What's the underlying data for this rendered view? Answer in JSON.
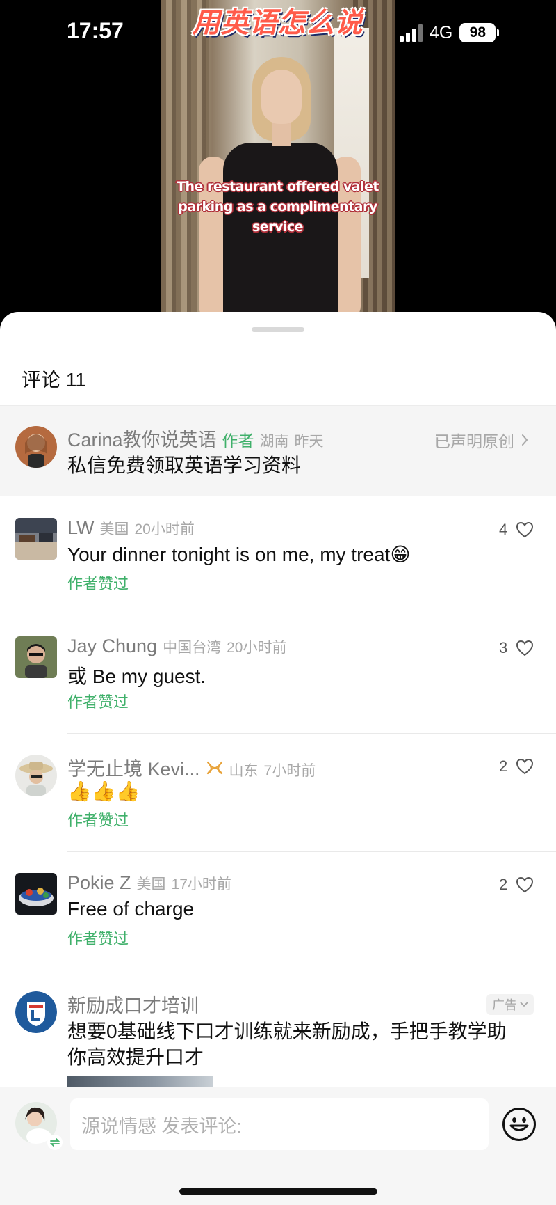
{
  "status_bar": {
    "time": "17:57",
    "network": "4G",
    "battery": "98"
  },
  "video": {
    "banner": "用英语怎么说",
    "caption": "The restaurant offered valet parking as a complimentary service"
  },
  "comments_sheet": {
    "title": "评论 11",
    "pinned": {
      "name": "Carina教你说英语",
      "author_tag": "作者",
      "location": "湖南",
      "time": "昨天",
      "declared": "已声明原创",
      "text": "私信免费领取英语学习资料"
    },
    "comments": [
      {
        "name": "LW",
        "location": "美国",
        "time": "20小时前",
        "text": "Your dinner tonight is on me, my treat😁",
        "liked_by_author": "作者赞过",
        "likes": "4"
      },
      {
        "name": "Jay Chung",
        "location": "中国台湾",
        "time": "20小时前",
        "text": "或 Be my guest.",
        "liked_by_author": "作者赞过",
        "likes": "3"
      },
      {
        "name": "学无止境 Kevi...",
        "location": "山东",
        "time": "7小时前",
        "text": "👍👍👍",
        "liked_by_author": "作者赞过",
        "likes": "2"
      },
      {
        "name": "Pokie Z",
        "location": "美国",
        "time": "17小时前",
        "text": "Free of charge",
        "liked_by_author": "作者赞过",
        "likes": "2"
      }
    ],
    "ad": {
      "name": "新励成口才培训",
      "tag": "广告",
      "text_line1": "想要0基础线下口才训练就来新励成，手把手教学助",
      "text_line2": "你高效提升口才"
    }
  },
  "composer": {
    "placeholder": "源说情感 发表评论:"
  },
  "colors": {
    "author_green": "#3fb06a",
    "sheet_bg": "#ffffff",
    "pinned_bg": "#f5f5f5"
  },
  "icons": [
    "heart-icon",
    "chevron-right-icon",
    "chevron-down-icon",
    "smiley-icon",
    "signal-icon",
    "battery-icon",
    "medal-badge-icon"
  ]
}
